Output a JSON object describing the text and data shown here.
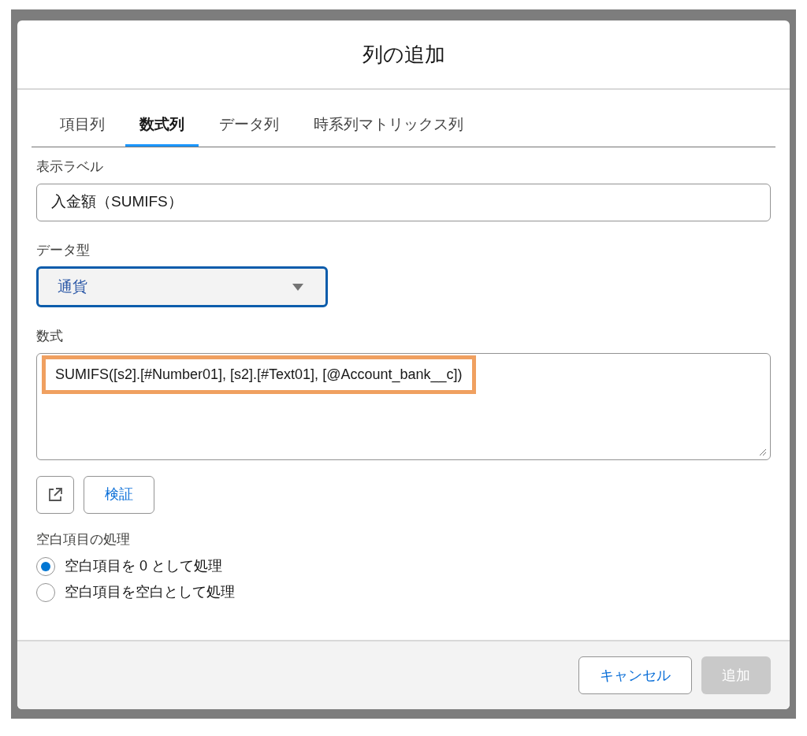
{
  "dialog": {
    "title": "列の追加"
  },
  "tabs": [
    {
      "label": "項目列",
      "selected": false
    },
    {
      "label": "数式列",
      "selected": true
    },
    {
      "label": "データ列",
      "selected": false
    },
    {
      "label": "時系列マトリックス列",
      "selected": false
    }
  ],
  "display_label": {
    "label": "表示ラベル",
    "value": "入金額（SUMIFS）"
  },
  "data_type": {
    "label": "データ型",
    "value": "通貨",
    "focused": true
  },
  "formula": {
    "label": "数式",
    "value": "SUMIFS([s2].[#Number01], [s2].[#Text01], [@Account_bank__c])",
    "highlighted": true
  },
  "validate_button": "検証",
  "blank_handling": {
    "label": "空白項目の処理",
    "options": [
      {
        "label": "空白項目を 0 として処理",
        "selected": true
      },
      {
        "label": "空白項目を空白として処理",
        "selected": false
      }
    ]
  },
  "footer": {
    "cancel": "キャンセル",
    "add": {
      "label": "追加",
      "disabled": true
    }
  }
}
